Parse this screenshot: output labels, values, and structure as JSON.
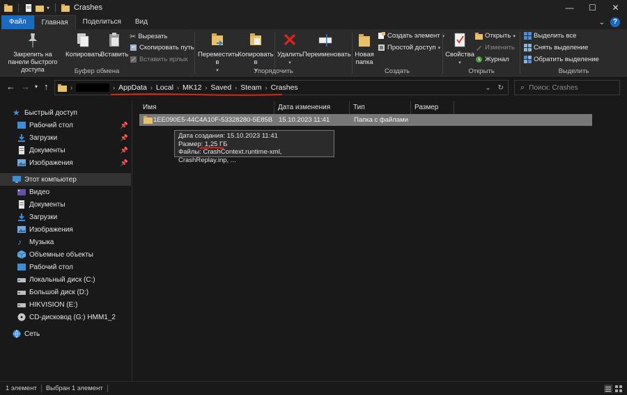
{
  "window": {
    "title": "Crashes"
  },
  "tabs": {
    "file": "Файл",
    "home": "Главная",
    "share": "Поделиться",
    "view": "Вид"
  },
  "ribbon": {
    "clipboard": {
      "pin": "Закрепить на панели быстрого доступа",
      "copy": "Копировать",
      "paste": "Вставить",
      "cut": "Вырезать",
      "copy_path": "Скопировать путь",
      "paste_shortcut": "Вставить ярлык",
      "label": "Буфер обмена"
    },
    "organize": {
      "move": "Переместить в",
      "copy_to": "Копировать в",
      "delete": "Удалить",
      "rename": "Переименовать",
      "label": "Упорядочить"
    },
    "new": {
      "new_folder": "Новая папка",
      "new_item": "Создать элемент",
      "easy_access": "Простой доступ",
      "label": "Создать"
    },
    "open": {
      "properties": "Свойства",
      "open": "Открыть",
      "edit": "Изменить",
      "history": "Журнал",
      "label": "Открыть"
    },
    "select": {
      "select_all": "Выделить все",
      "select_none": "Снять выделение",
      "invert": "Обратить выделение",
      "label": "Выделить"
    }
  },
  "address": {
    "crumbs": [
      "AppData",
      "Local",
      "MK12",
      "Saved",
      "Steam",
      "Crashes"
    ],
    "search_placeholder": "Поиск: Crashes"
  },
  "nav": {
    "quick_access": "Быстрый доступ",
    "quick_items": [
      "Рабочий стол",
      "Загрузки",
      "Документы",
      "Изображения"
    ],
    "this_pc": "Этот компьютер",
    "pc_items": [
      "Видео",
      "Документы",
      "Загрузки",
      "Изображения",
      "Музыка",
      "Объемные объекты",
      "Рабочий стол",
      "Локальный диск (C:)",
      "Большой диск (D:)",
      "HIKVISION (E:)",
      "CD-дисковод (G:) HMM1_2"
    ],
    "network": "Сеть"
  },
  "columns": {
    "name": "Имя",
    "date": "Дата изменения",
    "type": "Тип",
    "size": "Размер"
  },
  "file": {
    "name": "1EE090E5-44C4A10F-53328280-5E85B",
    "date": "15.10.2023 11:41",
    "type": "Папка с файлами"
  },
  "tooltip": {
    "created": "Дата создания: 15.10.2023 11:41",
    "size": "Размер: 1,25 ГБ",
    "files": "Файлы: CrashContext.runtime-xml, CrashReplay.inp, ..."
  },
  "status": {
    "count": "1 элемент",
    "selected": "Выбран 1 элемент"
  },
  "colors": {
    "accent": "#1a6bbf",
    "annotation": "#e0241b",
    "folder": "#e8c16a"
  }
}
